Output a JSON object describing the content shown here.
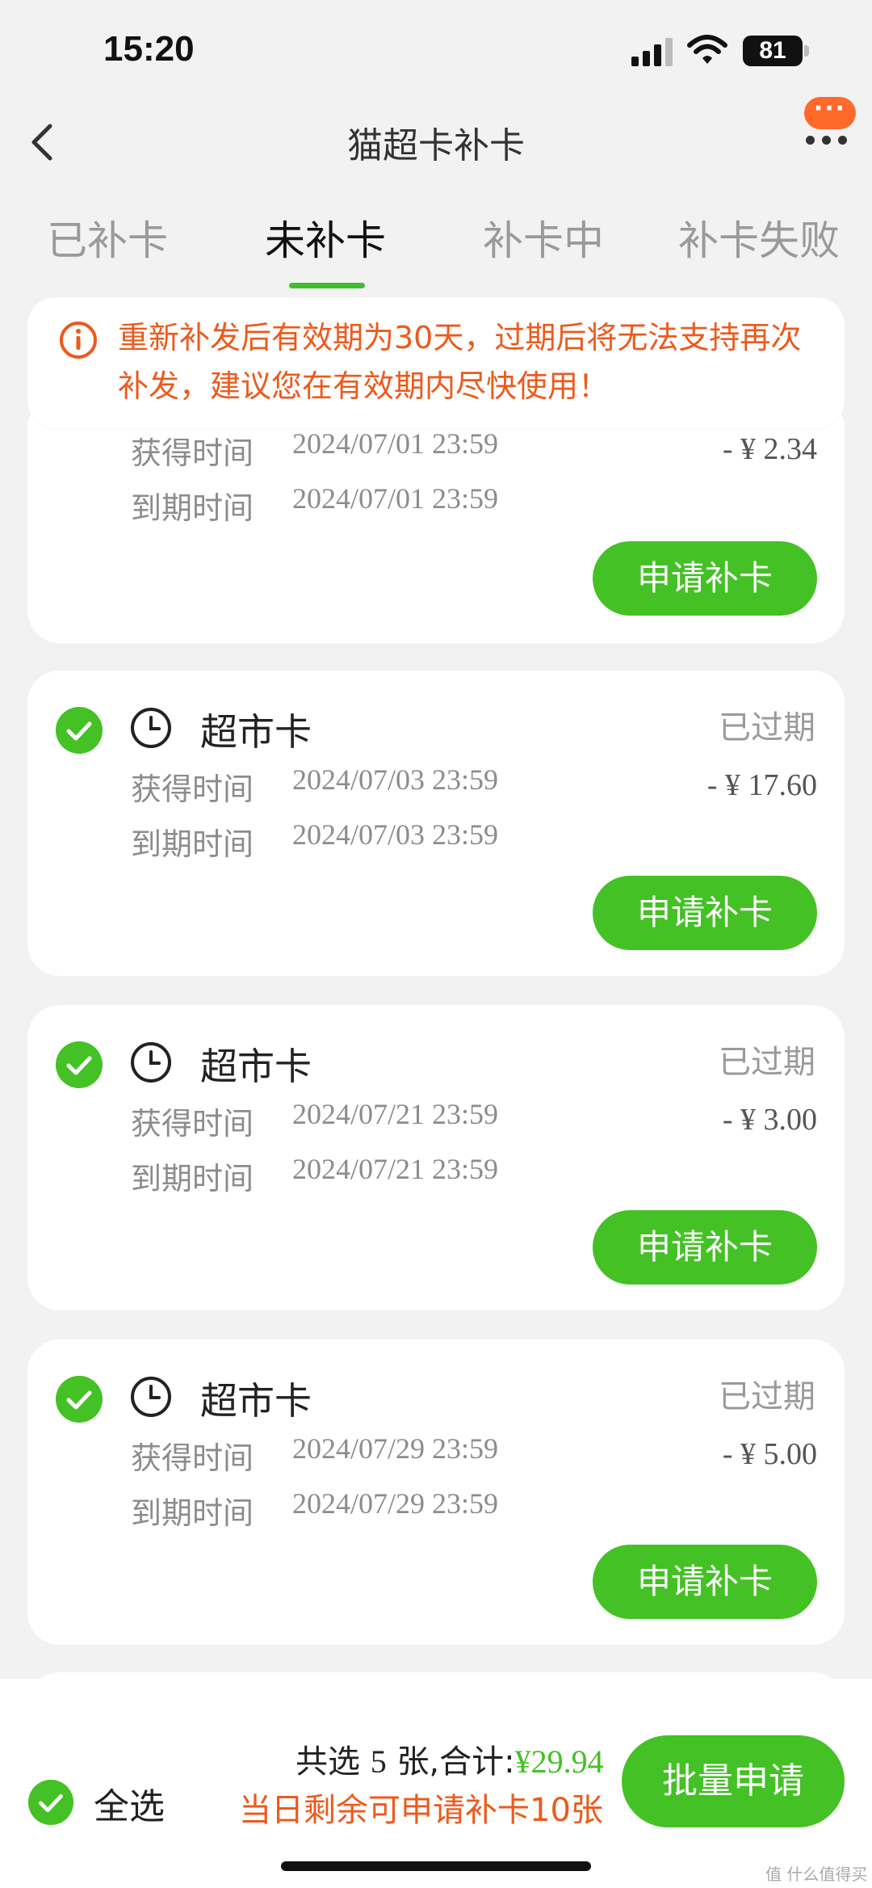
{
  "status_bar": {
    "time": "15:20",
    "battery": "81"
  },
  "nav": {
    "title": "猫超卡补卡",
    "more_label": "···"
  },
  "tabs": [
    {
      "label": "已补卡"
    },
    {
      "label": "未补卡"
    },
    {
      "label": "补卡中"
    },
    {
      "label": "补卡失败"
    }
  ],
  "active_tab": "未补卡",
  "notice": {
    "text": "重新补发后有效期为30天，过期后将无法支持再次补发，建议您在有效期内尽快使用！"
  },
  "labels": {
    "obtained": "获得时间",
    "expires": "到期时间",
    "apply": "申请补卡"
  },
  "cards": [
    {
      "name": "",
      "status": "",
      "obtained": "2024/07/01 23:59",
      "expires": "2024/07/01 23:59",
      "amount": "- ¥ 2.34",
      "checked": true
    },
    {
      "name": "超市卡",
      "status": "已过期",
      "obtained": "2024/07/03 23:59",
      "expires": "2024/07/03 23:59",
      "amount": "- ¥ 17.60",
      "checked": true
    },
    {
      "name": "超市卡",
      "status": "已过期",
      "obtained": "2024/07/21 23:59",
      "expires": "2024/07/21 23:59",
      "amount": "- ¥ 3.00",
      "checked": true
    },
    {
      "name": "超市卡",
      "status": "已过期",
      "obtained": "2024/07/29 23:59",
      "expires": "2024/07/29 23:59",
      "amount": "- ¥ 5.00",
      "checked": true
    }
  ],
  "bottom_bar": {
    "select_all": "全选",
    "summary_prefix": "共选",
    "count": "5",
    "summary_mid": "张,合计:",
    "total": "¥29.94",
    "remaining": "当日剩余可申请补卡10张",
    "batch_button": "批量申请"
  },
  "watermark": "值 什么值得买",
  "colors": {
    "accent_green": "#44c125",
    "warning_orange": "#ec5a1c",
    "tab_underline": "#3fbf2f"
  }
}
